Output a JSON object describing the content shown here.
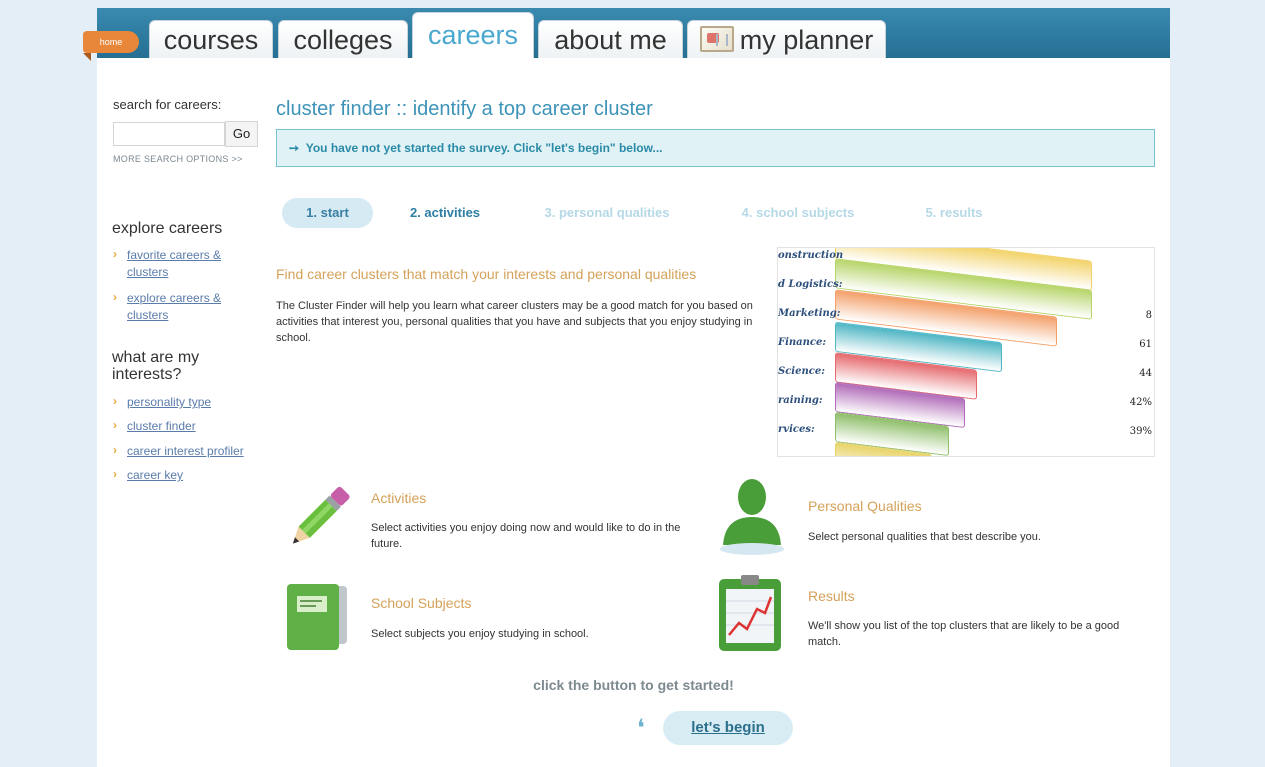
{
  "nav": {
    "home": "home",
    "tabs": [
      "courses",
      "colleges",
      "careers",
      "about me",
      "my planner"
    ],
    "active": "careers"
  },
  "sidebar": {
    "search_label": "search for careers:",
    "search_value": "",
    "go": "Go",
    "more_options": "MORE SEARCH OPTIONS >>",
    "explore_heading": "explore careers",
    "explore_links": [
      "favorite careers &",
      "clusters",
      "explore careers &",
      "clusters"
    ],
    "interests_heading_1": "what are my",
    "interests_heading_2": "interests?",
    "interest_links": [
      "personality type",
      "cluster finder",
      "career interest profiler",
      "career key"
    ]
  },
  "main": {
    "title": "cluster finder :: identify a top career cluster",
    "notice": "You have not yet started the survey. Click \"let's begin\" below...",
    "steps": [
      "1. start",
      "2. activities",
      "3. personal qualities",
      "4. school subjects",
      "5. results"
    ],
    "intro_heading": "Find career clusters that match your interests and personal qualities",
    "intro_body": "The Cluster Finder will help you learn what career clusters may be a good match for you based on activities that interest you, personal qualities that you have and subjects that you enjoy studying in school.",
    "banner": {
      "labels": [
        "onstruction",
        "d Logistics:",
        "Marketing:",
        "Finance:",
        "Science:",
        "raining:",
        "rvices:"
      ],
      "percents": [
        "8",
        "61",
        "44",
        "42%",
        "39%"
      ],
      "colors": [
        "#f2d36a",
        "#b7d56a",
        "#f3a06a",
        "#4fb6c4",
        "#e56a6e",
        "#b06bb8",
        "#8fbf6a",
        "#e8d46a"
      ]
    },
    "cards": [
      {
        "icon": "pencil-icon",
        "title": "Activities",
        "desc": "Select activities you enjoy doing now and would like to do in the future."
      },
      {
        "icon": "person-icon",
        "title": "Personal Qualities",
        "desc": "Select personal qualities that best describe you."
      },
      {
        "icon": "notebook-icon",
        "title": "School Subjects",
        "desc": "Select subjects you enjoy studying in school."
      },
      {
        "icon": "clipboard-chart-icon",
        "title": "Results",
        "desc": "We'll show you list of the top clusters that are likely to be a good match."
      }
    ],
    "cta": "click the button to get started!",
    "begin": "let's begin"
  }
}
